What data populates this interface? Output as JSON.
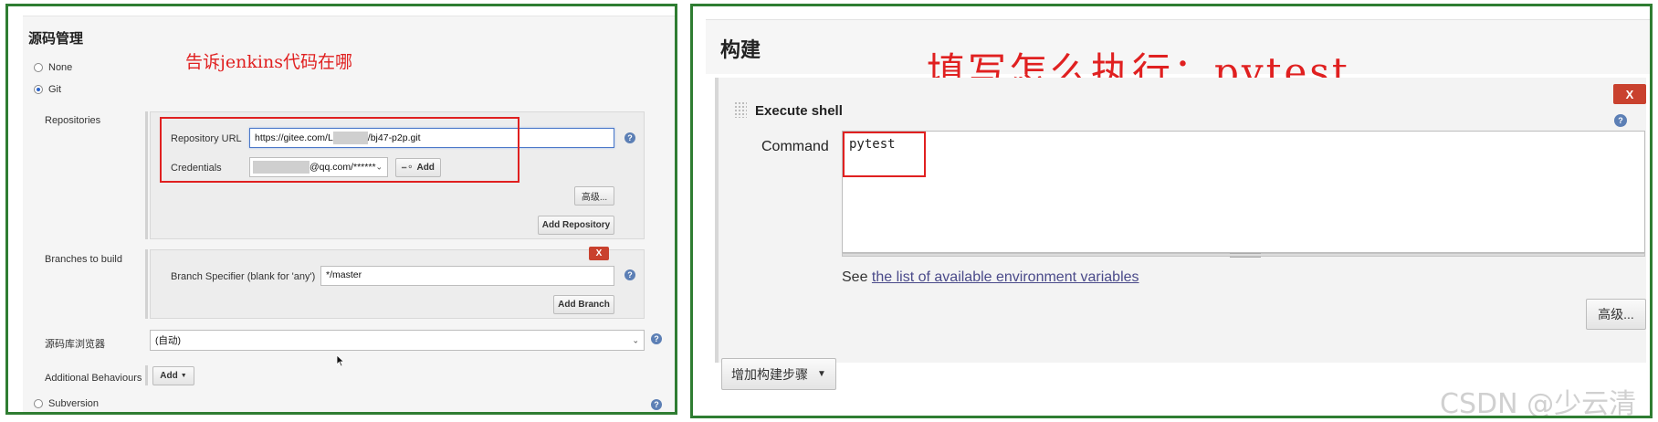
{
  "left": {
    "section_title": "源码管理",
    "annotation": "告诉jenkins代码在哪",
    "scm_options": {
      "none": "None",
      "git": "Git",
      "subversion": "Subversion"
    },
    "repositories": {
      "label": "Repositories",
      "url_label": "Repository URL",
      "url_prefix": "https://gitee.com/L",
      "url_suffix": "/bj47-p2p.git",
      "credentials_label": "Credentials",
      "credentials_value": "@qq.com/******",
      "add_label": "Add",
      "advanced_label": "高级...",
      "add_repository_label": "Add Repository"
    },
    "branches": {
      "label": "Branches to build",
      "specifier_label": "Branch Specifier (blank for 'any')",
      "specifier_value": "*/master",
      "delete_label": "X",
      "add_branch_label": "Add Branch"
    },
    "browser": {
      "label": "源码库浏览器",
      "value": "(自动)"
    },
    "additional": {
      "label": "Additional Behaviours",
      "add_label": "Add"
    },
    "help_glyph": "?"
  },
  "right": {
    "section_title": "构建",
    "annotation": "填写怎么执行：pytest",
    "step_title": "Execute shell",
    "delete_label": "X",
    "command_label": "Command",
    "command_value": "pytest",
    "see_text": "See",
    "env_link": "the list of available environment variables",
    "advanced_label": "高级...",
    "add_step_label": "增加构建步骤"
  },
  "watermark": "CSDN @少云清",
  "colors": {
    "frame_green": "#2f7d32",
    "highlight_red": "#e02020",
    "delete_red": "#c9412e",
    "help_blue": "#5c7fb5"
  }
}
